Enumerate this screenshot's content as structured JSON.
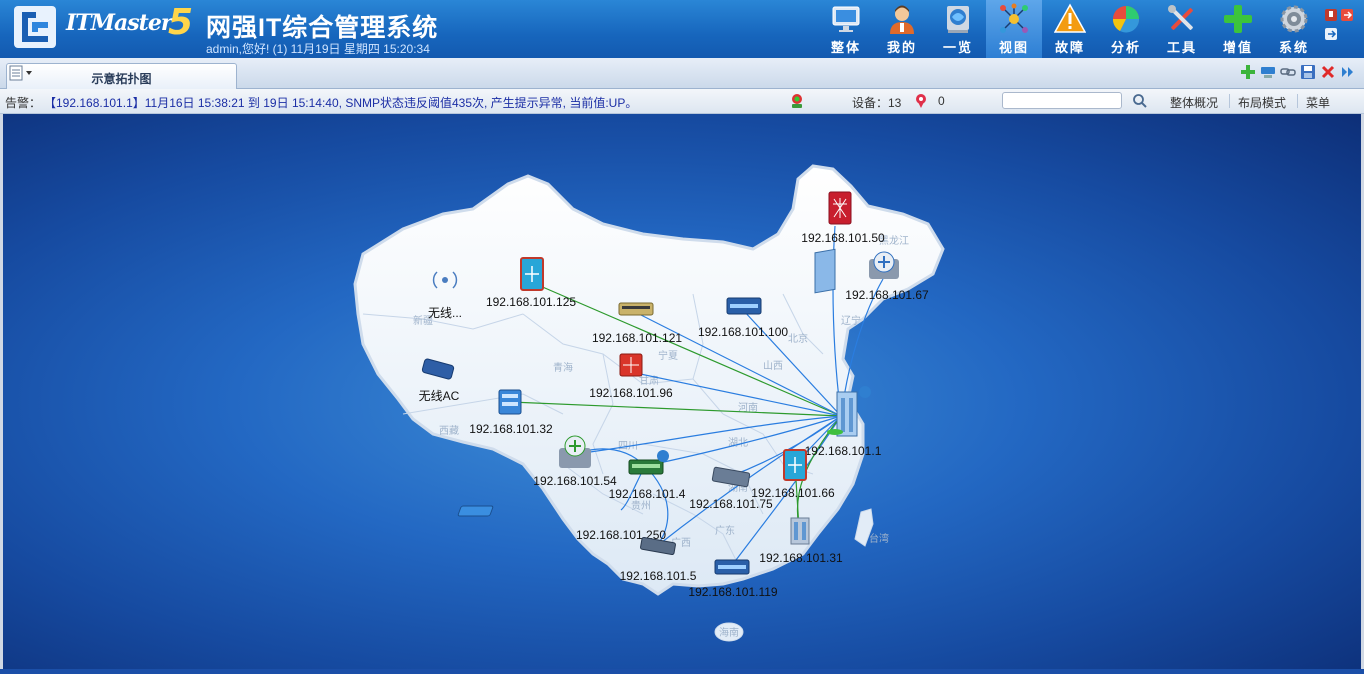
{
  "header": {
    "brand": "ITMaster",
    "brand_version": "5",
    "title": "网强IT综合管理系统",
    "user_info": "admin,您好! (1) 11月19日 星期四 15:20:34",
    "accent_color": "#1766bd"
  },
  "nav": [
    {
      "label": "整体",
      "icon": "monitor-icon"
    },
    {
      "label": "我的",
      "icon": "user-icon"
    },
    {
      "label": "一览",
      "icon": "overview-icon"
    },
    {
      "label": "视图",
      "icon": "topology-icon",
      "active": true
    },
    {
      "label": "故障",
      "icon": "warning-icon"
    },
    {
      "label": "分析",
      "icon": "pie-chart-icon"
    },
    {
      "label": "工具",
      "icon": "tools-icon"
    },
    {
      "label": "增值",
      "icon": "plus-icon"
    },
    {
      "label": "系统",
      "icon": "gear-icon"
    }
  ],
  "tab": {
    "label": "示意拓扑图"
  },
  "alarm": {
    "label": "告警：",
    "text": "【192.168.101.1】11月16日 15:38:21 到 19日 15:14:40, SNMP状态违反阈值435次, 产生提示异常, 当前值:UP。",
    "devices_label": "设备：13",
    "alerts_value": "0",
    "search_placeholder": "",
    "menu": [
      "整体概况",
      "布局模式",
      "菜单"
    ]
  },
  "topology": {
    "provinces": [
      "新疆",
      "西藏",
      "青海",
      "甘肃",
      "宁夏",
      "四川",
      "湖北",
      "河南",
      "山西",
      "北京",
      "辽宁",
      "黑龙江",
      "广西",
      "广东",
      "贵州",
      "湖南",
      "台湾",
      "海南"
    ],
    "devices": [
      {
        "label": "192.168.101.50",
        "icon": "firewall-icon"
      },
      {
        "label": "192.168.101.67",
        "icon": "router-icon"
      },
      {
        "label": "192.168.101.125",
        "icon": "switch-core-icon"
      },
      {
        "label": "无线...",
        "icon": "wireless-icon"
      },
      {
        "label": "192.168.101.121",
        "icon": "switch-icon"
      },
      {
        "label": "192.168.101.100",
        "icon": "switch-icon"
      },
      {
        "label": "192.168.101.96",
        "icon": "firewall-icon"
      },
      {
        "label": "无线AC",
        "icon": "access-controller-icon"
      },
      {
        "label": "192.168.101.32",
        "icon": "server-icon"
      },
      {
        "label": "192.168.101.1",
        "icon": "core-building-icon"
      },
      {
        "label": "192.168.101.54",
        "icon": "router-icon"
      },
      {
        "label": "192.168.101.4",
        "icon": "switch-icon"
      },
      {
        "label": "192.168.101.75",
        "icon": "switch-icon"
      },
      {
        "label": "192.168.101.66",
        "icon": "switch-core-icon"
      },
      {
        "label": "192.168.101.250",
        "icon": "switch-icon"
      },
      {
        "label": "192.168.101.31",
        "icon": "building-icon"
      },
      {
        "label": "192.168.101.5",
        "icon": "switch-icon"
      },
      {
        "label": "192.168.101.119",
        "icon": "switch-icon"
      }
    ]
  }
}
